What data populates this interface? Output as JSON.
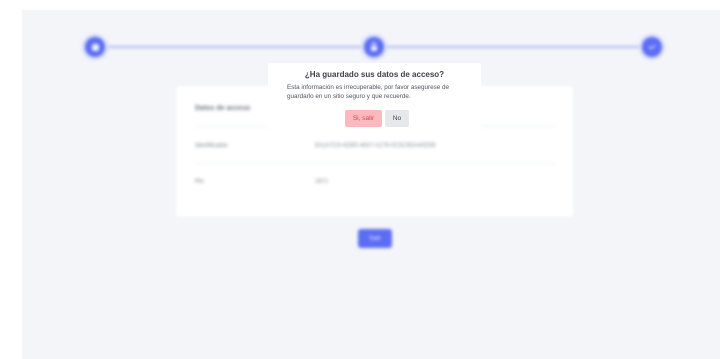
{
  "stepper": {
    "steps": [
      {
        "icon": "square-icon",
        "state": "done"
      },
      {
        "icon": "lock-icon",
        "state": "current"
      },
      {
        "icon": "check-icon",
        "state": "pending"
      }
    ],
    "accent": "#5b6df2"
  },
  "card": {
    "title": "Datos de acceso",
    "rows": [
      {
        "label": "Identificador",
        "value": "8A1A7C9-4DB5-4837-A278-0C5C9DA40D56"
      },
      {
        "label": "Pin",
        "value": "2871"
      }
    ]
  },
  "exit_button": {
    "label": "Salir"
  },
  "modal": {
    "title": "¿Ha guardado sus datos de acceso?",
    "body": "Esta información es irrecuperable, por favor asegurese de guardarlo en un sitio seguro y que recuerde.",
    "confirm_label": "Si, salir",
    "cancel_label": "No",
    "colors": {
      "confirm_bg": "#f9b9bd",
      "confirm_text": "#d94550",
      "cancel_bg": "#e6e8ec"
    }
  }
}
